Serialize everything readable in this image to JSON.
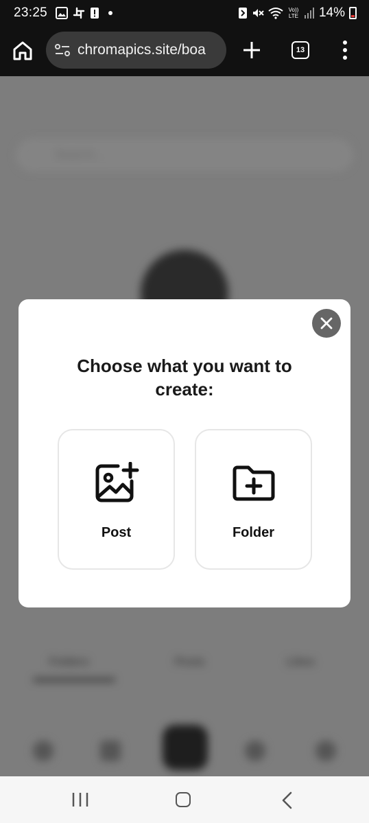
{
  "status_bar": {
    "time": "23:25",
    "battery": "14%",
    "network": "Vo)) LTE",
    "left_icons": [
      "image-icon",
      "slack-icon",
      "alert-icon"
    ],
    "right_icons": [
      "nfc-icon",
      "mute-icon",
      "wifi-icon",
      "lte-icon",
      "signal-icon",
      "battery-icon"
    ]
  },
  "browser": {
    "url": "chromapics.site/boa",
    "tab_count": "13"
  },
  "background_page": {
    "search_placeholder": "Search...",
    "tabs": [
      "Folders",
      "Posts",
      "Likes"
    ]
  },
  "modal": {
    "title": "Choose what you want to create:",
    "options": [
      {
        "label": "Post",
        "icon": "add-image-icon"
      },
      {
        "label": "Folder",
        "icon": "add-folder-icon"
      }
    ]
  },
  "colors": {
    "overlay": "#7d7d7d",
    "modal_bg": "#ffffff",
    "close_button": "#666666",
    "toolbar_bg": "#111111",
    "urlbar_bg": "#3a3a3a"
  }
}
